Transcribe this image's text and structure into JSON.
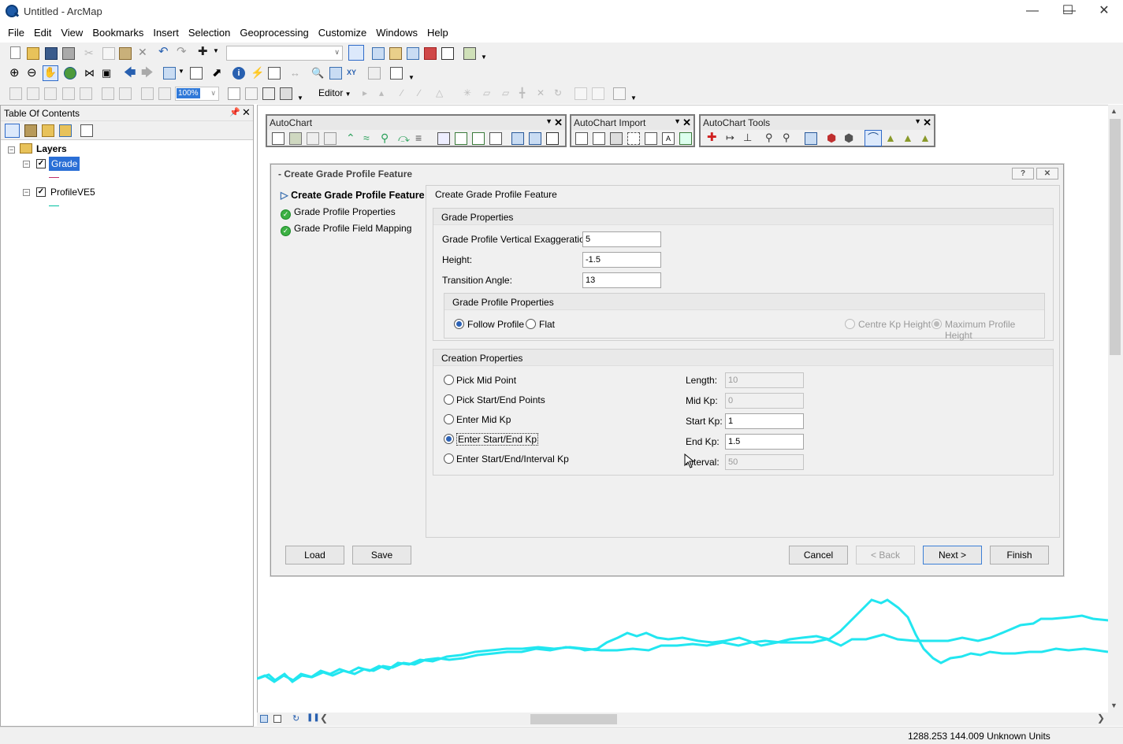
{
  "window": {
    "title": "Untitled - ArcMap"
  },
  "menu": [
    "File",
    "Edit",
    "View",
    "Bookmarks",
    "Insert",
    "Selection",
    "Geoprocessing",
    "Customize",
    "Windows",
    "Help"
  ],
  "toolbar": {
    "scale_value": "",
    "zoom_value": "100%",
    "editor_label": "Editor"
  },
  "toc": {
    "title": "Table Of Contents",
    "root_label": "Layers",
    "layers": [
      {
        "name": "Grade",
        "checked": true,
        "selected": true,
        "symbol_color": "#c0306a"
      },
      {
        "name": "ProfileVE5",
        "checked": true,
        "selected": false,
        "symbol_color": "#00c0a0"
      }
    ]
  },
  "floating_toolbars": [
    {
      "title": "AutoChart"
    },
    {
      "title": "AutoChart Import"
    },
    {
      "title": "AutoChart Tools"
    }
  ],
  "dialog": {
    "title": "- Create Grade Profile Feature",
    "help_label": "?",
    "close_label": "✕",
    "nav": [
      {
        "label": "Create Grade Profile Feature",
        "state": "current"
      },
      {
        "label": "Grade Profile Properties",
        "state": "done"
      },
      {
        "label": "Grade Profile Field Mapping",
        "state": "done"
      }
    ],
    "page_title": "Create Grade Profile Feature",
    "grade_properties": {
      "header": "Grade Properties",
      "ve_label": "Grade Profile Vertical Exaggeration:",
      "ve_value": "5",
      "height_label": "Height:",
      "height_value": "-1.5",
      "angle_label": "Transition Angle:",
      "angle_value": "13",
      "sub_header": "Grade Profile Properties",
      "follow_label": "Follow Profile",
      "flat_label": "Flat",
      "centre_label": "Centre Kp Height",
      "max_label": "Maximum Profile Height"
    },
    "creation_properties": {
      "header": "Creation Properties",
      "options": [
        "Pick Mid Point",
        "Pick Start/End Points",
        "Enter Mid Kp",
        "Enter Start/End Kp",
        "Enter Start/End/Interval Kp"
      ],
      "selected_option": "Enter Start/End Kp",
      "length_label": "Length:",
      "length_value": "10",
      "midkp_label": "Mid Kp:",
      "midkp_value": "0",
      "startkp_label": "Start Kp:",
      "startkp_value": "1",
      "endkp_label": "End Kp:",
      "endkp_value": "1.5",
      "interval_label": "Interval:",
      "interval_value": "50"
    },
    "buttons": {
      "load": "Load",
      "save": "Save",
      "cancel": "Cancel",
      "back": "< Back",
      "next": "Next >",
      "finish": "Finish"
    }
  },
  "map": {
    "profile_color": "#22e6f0"
  },
  "status": {
    "coordinates": "1288.253  144.009 Unknown Units"
  }
}
